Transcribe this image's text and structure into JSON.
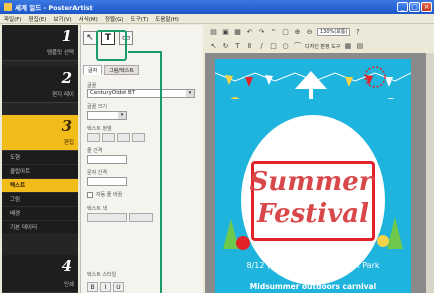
{
  "window": {
    "title": "세계 일드 - PosterArtist"
  },
  "menu": [
    "파일(F)",
    "편집(E)",
    "보기(V)",
    "서식(M)",
    "정렬(G)",
    "도구(T)",
    "도움말(H)"
  ],
  "steps": [
    {
      "num": "1",
      "label": "템플릿 선택"
    },
    {
      "num": "2",
      "label": "편지 레이"
    },
    {
      "num": "3",
      "label": "편집"
    },
    {
      "num": "4",
      "label": "인쇄"
    }
  ],
  "subitems": [
    "도형",
    "클립아트",
    "텍스트",
    "그림",
    "배경",
    "기본 데이터"
  ],
  "panel": {
    "tabs": [
      "글자",
      "그림/텍스트"
    ],
    "font_label": "글꼴",
    "font_value": "CenturyOldst BT",
    "size_label": "글꼴 크기",
    "style_label": "텍스트 정렬",
    "spacing_label": "줄 간격",
    "char_label": "문자 간격",
    "checkbox_label": "자동 줄 바꿈",
    "color_label": "텍스트 색",
    "effect_label": "텍스트 스타일",
    "fmt": [
      "B",
      "I",
      "U"
    ]
  },
  "toolbar": {
    "zoom": "130%(보통)",
    "tool_labels": [
      "디자인 판정 도구"
    ]
  },
  "poster": {
    "title_line1": "Summer",
    "title_line2": "Festival",
    "date": "8/12 (Sun) from 13:00  XXXX Park",
    "footer": "Midsummer outdoors carnival"
  }
}
